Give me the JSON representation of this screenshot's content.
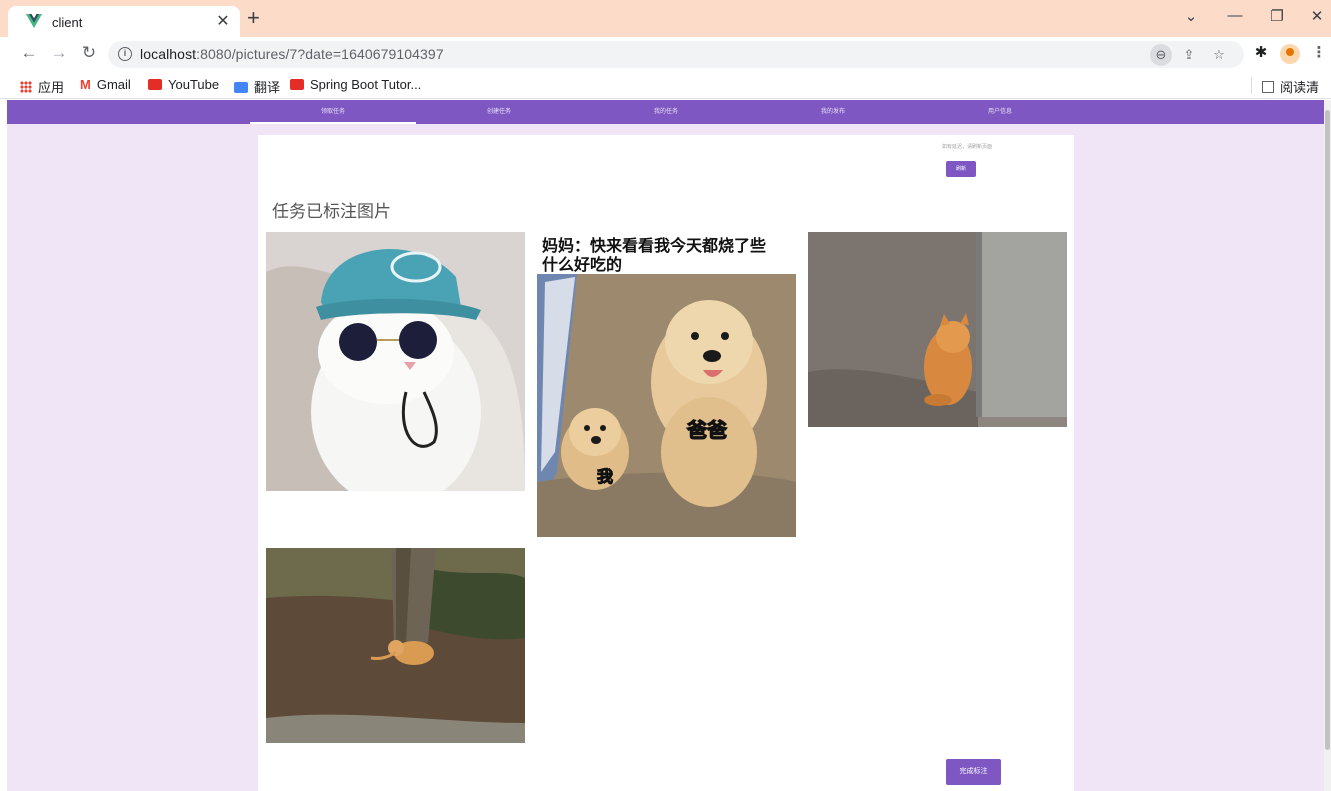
{
  "browser": {
    "tab_title": "client",
    "tab_close": "✕",
    "new_tab": "+",
    "url_host": "localhost",
    "url_rest": ":8080/pictures/7?date=1640679104397",
    "window_controls": [
      "⌄",
      "—",
      "❐",
      "✕"
    ]
  },
  "bookmarks": {
    "items": [
      "应用",
      "Gmail",
      "YouTube",
      "翻译",
      "Spring Boot Tutor..."
    ],
    "reading_list": "阅读清单"
  },
  "app": {
    "nav": [
      "领取任务",
      "创建任务",
      "我的任务",
      "我的发布",
      "用户信息"
    ],
    "hint": "如有延迟，请刷新页面",
    "refresh_label": "刷新",
    "title": "任务已标注图片",
    "done_label": "完成标注"
  },
  "images": {
    "meme_caption_line1": "妈妈：快来看看我今天都烧了些",
    "meme_caption_line2": "什么好吃的",
    "meme_label_big": "爸爸",
    "meme_label_small": "我"
  },
  "colors": {
    "accent": "#7e57c2",
    "page_bg": "#f0e5f6",
    "tabstrip_bg": "#fcdcc9"
  }
}
